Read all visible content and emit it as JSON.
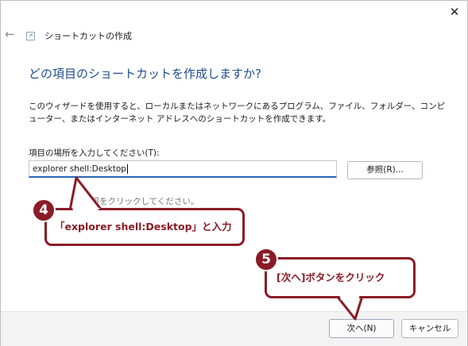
{
  "window": {
    "close_glyph": "✕",
    "back_glyph": "←",
    "title": "ショートカットの作成"
  },
  "wizard": {
    "heading": "どの項目のショートカットを作成しますか?",
    "description": "このウィザードを使用すると、ローカルまたはネットワークにあるプログラム、ファイル、フォルダー、コンピューター、またはインターネット アドレスへのショートカットを作成できます。",
    "location_label": "項目の場所を入力してください(T):",
    "location_value": "explorer shell:Desktop",
    "browse_button": "参照(R)...",
    "partially_hidden_hint": "参照をクリックしてください。"
  },
  "footer": {
    "next_button": "次へ(N)",
    "cancel_button": "キャンセル"
  },
  "annotations": {
    "step4_number": "4",
    "step4_text": "「explorer shell:Desktop」と入力",
    "step5_number": "5",
    "step5_text": "[次へ]ボタンをクリック",
    "accent_color": "#8a1c26"
  }
}
